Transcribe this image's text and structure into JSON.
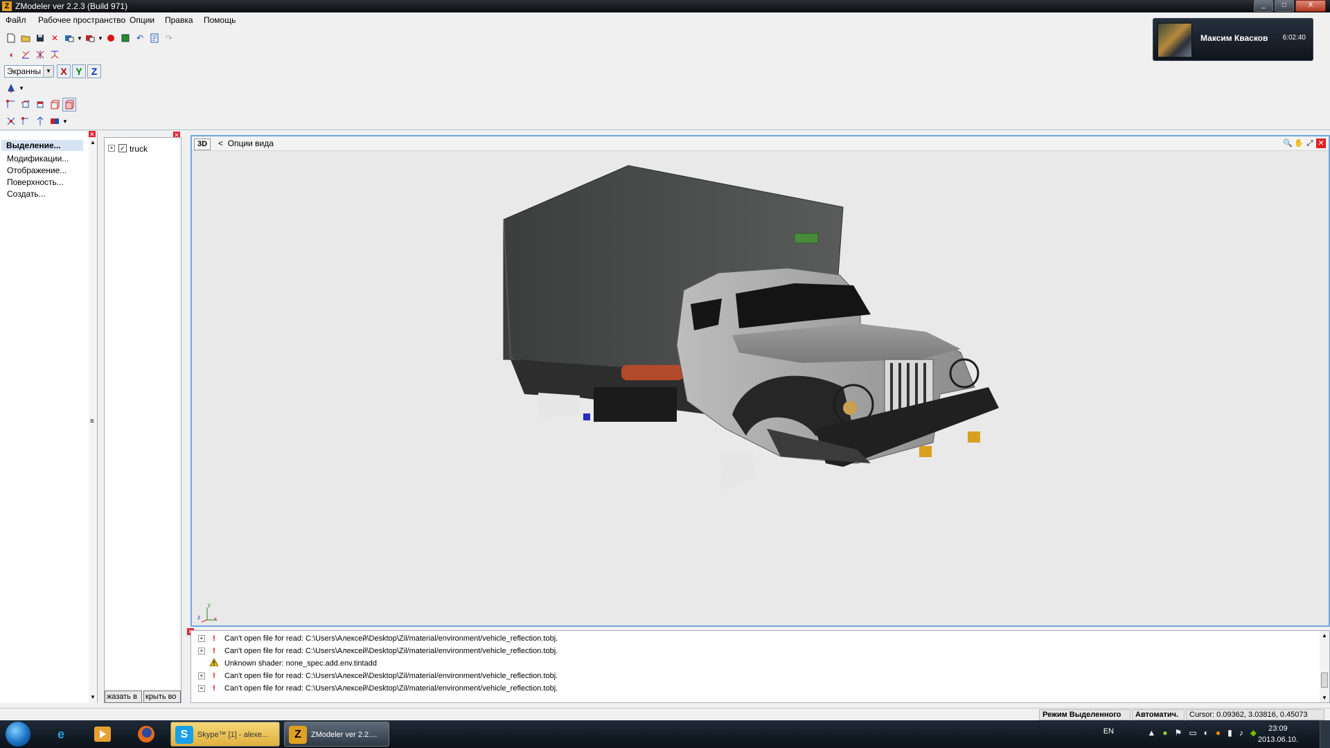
{
  "window": {
    "title": "ZModeler ver 2.2.3 (Build 971)",
    "app_icon_letter": "Z",
    "controls": [
      "_",
      "□",
      "X"
    ]
  },
  "menu": [
    "Файл",
    "Рабочее пространство",
    "Опции",
    "Правка",
    "Помощь"
  ],
  "toolbar": {
    "coord_mode": "Экранны",
    "axes": [
      "X",
      "Y",
      "Z"
    ],
    "axis_colors": {
      "x": "#c00000",
      "y": "#008000",
      "z": "#0030c0"
    }
  },
  "notification": {
    "name": "Максим Квасков",
    "time": "6:02:40"
  },
  "left_panel": {
    "items": [
      "Выделение...",
      "Модификации...",
      "Отображение...",
      "Поверхность...",
      "Создать..."
    ],
    "selected_index": 0
  },
  "tree": {
    "root_label": "truck",
    "checked": true,
    "buttons": [
      "жазать в",
      "крыть во"
    ]
  },
  "viewport": {
    "mode_button": "3D",
    "options_label": "Опции вида",
    "back_arrow": "<",
    "axis_labels": [
      "y",
      "z",
      "x"
    ]
  },
  "log": {
    "entries": [
      {
        "kind": "error",
        "text": "Can't open file for read: C:\\Users\\Алексей\\Desktop\\Zil/material/environment/vehicle_reflection.tobj."
      },
      {
        "kind": "error",
        "text": "Can't open file for read: C:\\Users\\Алексей\\Desktop\\Zil/material/environment/vehicle_reflection.tobj."
      },
      {
        "kind": "warning",
        "text": "Unknown shader: none_spec.add.env.tintadd"
      },
      {
        "kind": "error",
        "text": "Can't open file for read: C:\\Users\\Алексей\\Desktop\\Zil/material/environment/vehicle_reflection.tobj."
      },
      {
        "kind": "error",
        "text": "Can't open file for read: C:\\Users\\Алексей\\Desktop\\Zil/material/environment/vehicle_reflection.tobj."
      }
    ]
  },
  "status": {
    "mode": "Режим Выделенного",
    "auto": "Автоматич.",
    "cursor": "Cursor: 0.09362, 3.03816, 0.45073"
  },
  "taskbar": {
    "tasks": [
      {
        "label": "Skype™ [1] - alexe...",
        "icon": "S",
        "active": false
      },
      {
        "label": "ZModeler ver 2.2....",
        "icon": "Z",
        "active": true
      }
    ],
    "language": "EN",
    "time": "23:09",
    "date": "2013.06.10."
  }
}
